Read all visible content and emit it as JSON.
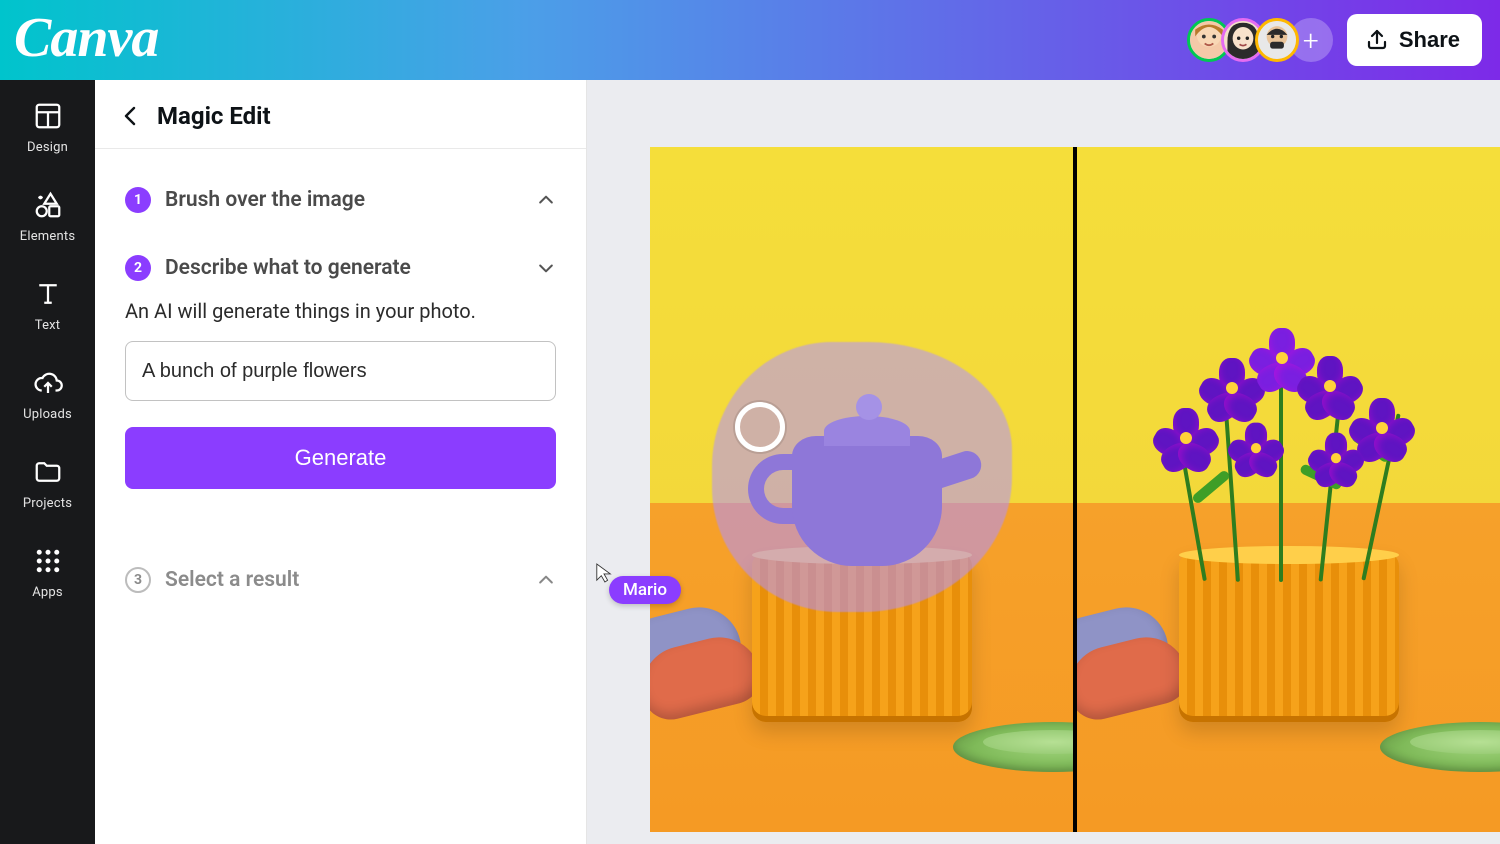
{
  "topbar": {
    "logo_text": "Canva",
    "share_label": "Share",
    "plus_label": "+"
  },
  "rail": {
    "items": [
      {
        "label": "Design"
      },
      {
        "label": "Elements"
      },
      {
        "label": "Text"
      },
      {
        "label": "Uploads"
      },
      {
        "label": "Projects"
      },
      {
        "label": "Apps"
      }
    ]
  },
  "panel": {
    "title": "Magic Edit",
    "steps": [
      {
        "num": "1",
        "title": "Brush over the image"
      },
      {
        "num": "2",
        "title": "Describe what to generate"
      },
      {
        "num": "3",
        "title": "Select a result"
      }
    ],
    "hint": "An AI will generate things in your photo.",
    "prompt_value": "A bunch of purple flowers",
    "generate_label": "Generate"
  },
  "cursor": {
    "user": "Mario"
  },
  "colors": {
    "accent": "#8b3dff"
  }
}
